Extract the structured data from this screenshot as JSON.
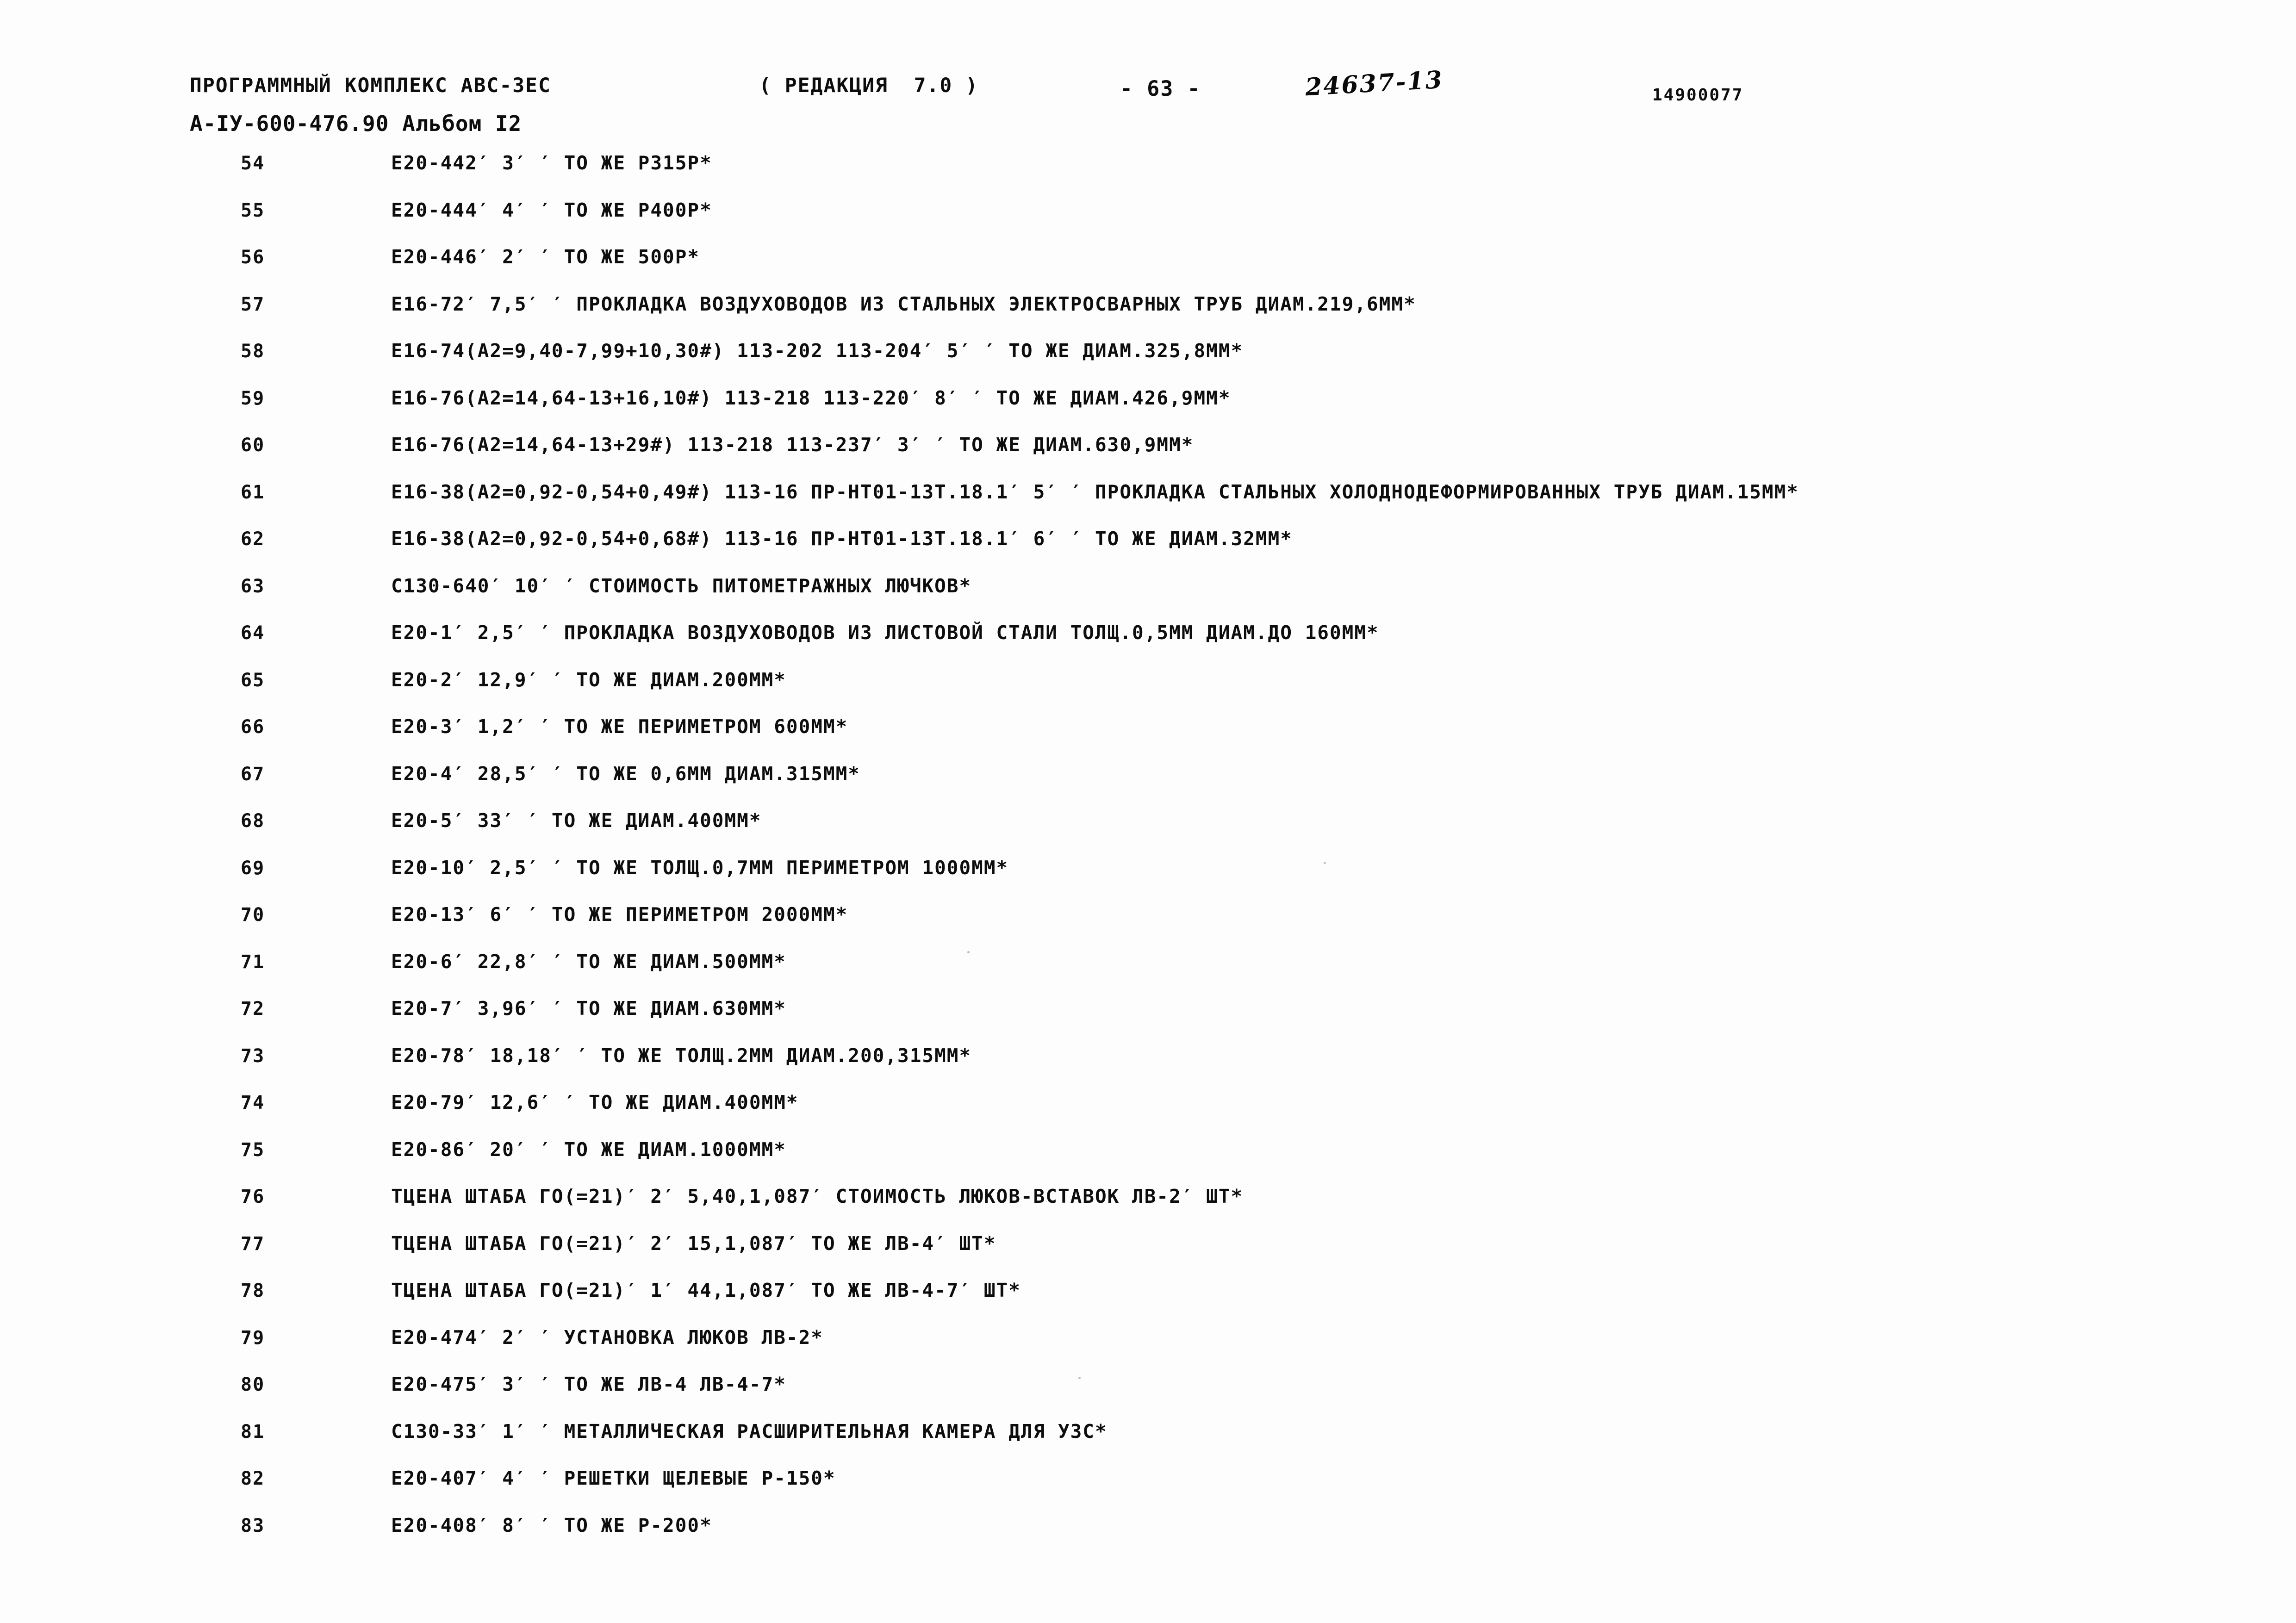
{
  "header": {
    "program_title": "ПРОГРАММНЫЙ КОМПЛЕКС АВС-3ЕС",
    "revision": "( РЕДАКЦИЯ  7.0 )",
    "page_number": "- 63 -",
    "handwritten_note": "24637-13",
    "document_code": "14900077",
    "album": "А-IУ-600-476.90 Альбом I2"
  },
  "listing": {
    "rows": [
      {
        "num": "54",
        "text": "Е20-442′ 3′ ′ ТО ЖЕ Р315Р*"
      },
      {
        "num": "55",
        "text": "Е20-444′ 4′ ′ ТО ЖЕ Р400Р*"
      },
      {
        "num": "56",
        "text": "Е20-446′ 2′ ′ ТО ЖЕ 500Р*"
      },
      {
        "num": "57",
        "text": "Е16-72′ 7,5′ ′ ПРОКЛАДКА ВОЗДУХОВОДОВ ИЗ СТАЛЬНЫХ ЭЛЕКТРОСВАРНЫХ ТРУБ ДИАМ.219,6ММ*"
      },
      {
        "num": "58",
        "text": "Е16-74(А2=9,40-7,99+10,30#) 113-202 113-204′ 5′ ′ ТО ЖЕ ДИАМ.325,8ММ*"
      },
      {
        "num": "59",
        "text": "Е16-76(А2=14,64-13+16,10#) 113-218 113-220′ 8′ ′ ТО ЖЕ ДИАМ.426,9ММ*"
      },
      {
        "num": "60",
        "text": "Е16-76(А2=14,64-13+29#) 113-218 113-237′ 3′ ′ ТО ЖЕ ДИАМ.630,9ММ*"
      },
      {
        "num": "61",
        "text": "Е16-38(А2=0,92-0,54+0,49#) 113-16 ПР-НТ01-13Т.18.1′ 5′ ′ ПРОКЛАДКА СТАЛЬНЫХ ХОЛОДНОДЕФОРМИРОВАННЫХ ТРУБ ДИАМ.15ММ*"
      },
      {
        "num": "62",
        "text": "Е16-38(А2=0,92-0,54+0,68#) 113-16 ПР-НТ01-13Т.18.1′ 6′ ′ ТО ЖЕ ДИАМ.32ММ*"
      },
      {
        "num": "63",
        "text": "С130-640′ 10′ ′ СТОИМОСТЬ ПИТОМЕТРАЖНЫХ ЛЮЧКОВ*"
      },
      {
        "num": "64",
        "text": "Е20-1′ 2,5′ ′ ПРОКЛАДКА ВОЗДУХОВОДОВ ИЗ ЛИСТОВОЙ СТАЛИ ТОЛЩ.0,5ММ ДИАМ.ДО 160ММ*"
      },
      {
        "num": "65",
        "text": "Е20-2′ 12,9′ ′ ТО ЖЕ ДИАМ.200ММ*"
      },
      {
        "num": "66",
        "text": "Е20-3′ 1,2′ ′ ТО ЖЕ ПЕРИМЕТРОМ 600ММ*"
      },
      {
        "num": "67",
        "text": "Е20-4′ 28,5′ ′ ТО ЖЕ 0,6ММ ДИАМ.315ММ*"
      },
      {
        "num": "68",
        "text": "Е20-5′ 33′ ′ ТО ЖЕ ДИАМ.400ММ*"
      },
      {
        "num": "69",
        "text": "Е20-10′ 2,5′ ′ ТО ЖЕ ТОЛЩ.0,7ММ ПЕРИМЕТРОМ 1000ММ*"
      },
      {
        "num": "70",
        "text": "Е20-13′ 6′ ′ ТО ЖЕ ПЕРИМЕТРОМ 2000ММ*"
      },
      {
        "num": "71",
        "text": "Е20-6′ 22,8′ ′ ТО ЖЕ ДИАМ.500ММ*"
      },
      {
        "num": "72",
        "text": "Е20-7′ 3,96′ ′ ТО ЖЕ ДИАМ.630ММ*"
      },
      {
        "num": "73",
        "text": "Е20-78′ 18,18′ ′ ТО ЖЕ ТОЛЩ.2ММ ДИАМ.200,315ММ*"
      },
      {
        "num": "74",
        "text": "Е20-79′ 12,6′ ′ ТО ЖЕ ДИАМ.400ММ*"
      },
      {
        "num": "75",
        "text": "Е20-86′ 20′ ′ ТО ЖЕ ДИАМ.1000ММ*"
      },
      {
        "num": "76",
        "text": "ТЦЕНА ШТАБА ГО(=21)′ 2′ 5,40,1,087′ СТОИМОСТЬ ЛЮКОВ-ВСТАВОК ЛВ-2′ ШТ*"
      },
      {
        "num": "77",
        "text": "ТЦЕНА ШТАБА ГО(=21)′ 2′ 15,1,087′ ТО ЖЕ ЛВ-4′ ШТ*"
      },
      {
        "num": "78",
        "text": "ТЦЕНА ШТАБА ГО(=21)′ 1′ 44,1,087′ ТО ЖЕ ЛВ-4-7′ ШТ*"
      },
      {
        "num": "79",
        "text": "Е20-474′ 2′ ′ УСТАНОВКА ЛЮКОВ ЛВ-2*"
      },
      {
        "num": "80",
        "text": "Е20-475′ 3′ ′ ТО ЖЕ ЛВ-4 ЛВ-4-7*"
      },
      {
        "num": "81",
        "text": "С130-33′ 1′ ′ МЕТАЛЛИЧЕСКАЯ РАСШИРИТЕЛЬНАЯ КАМЕРА ДЛЯ УЗС*"
      },
      {
        "num": "82",
        "text": "Е20-407′ 4′ ′ РЕШЕТКИ ЩЕЛЕВЫЕ Р-150*"
      },
      {
        "num": "83",
        "text": "Е20-408′ 8′ ′ ТО ЖЕ Р-200*"
      }
    ]
  }
}
